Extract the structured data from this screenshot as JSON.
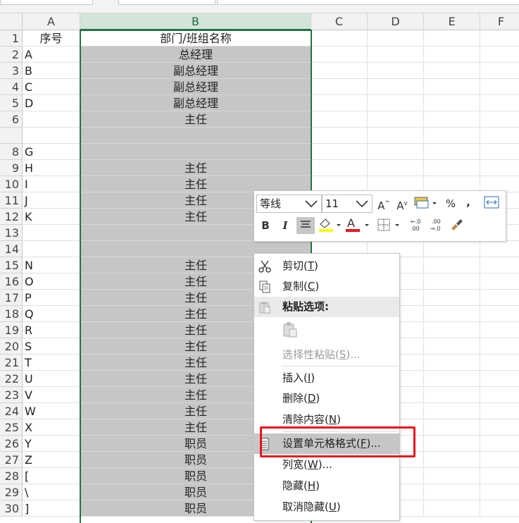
{
  "columns": [
    "A",
    "B",
    "C",
    "D",
    "E",
    "F"
  ],
  "header_row": {
    "row": "1",
    "a": "序号",
    "b": "部门/班组名称"
  },
  "rows": [
    {
      "num": "2",
      "a": "A",
      "b": "总经理"
    },
    {
      "num": "3",
      "a": "B",
      "b": "副总经理"
    },
    {
      "num": "4",
      "a": "C",
      "b": "副总经理"
    },
    {
      "num": "5",
      "a": "D",
      "b": "副总经理"
    },
    {
      "num": "6",
      "a": "",
      "b": "主任"
    },
    {
      "num": "",
      "a": "",
      "b": ""
    },
    {
      "num": "8",
      "a": "G",
      "b": ""
    },
    {
      "num": "9",
      "a": "H",
      "b": "主任"
    },
    {
      "num": "10",
      "a": "I",
      "b": "主任"
    },
    {
      "num": "11",
      "a": "J",
      "b": "主任"
    },
    {
      "num": "12",
      "a": "K",
      "b": "主任"
    },
    {
      "num": "13",
      "a": "",
      "b": ""
    },
    {
      "num": "14",
      "a": "",
      "b": ""
    },
    {
      "num": "15",
      "a": "N",
      "b": "主任"
    },
    {
      "num": "16",
      "a": "O",
      "b": "主任"
    },
    {
      "num": "17",
      "a": "P",
      "b": "主任"
    },
    {
      "num": "18",
      "a": "Q",
      "b": "主任"
    },
    {
      "num": "19",
      "a": "R",
      "b": "主任"
    },
    {
      "num": "20",
      "a": "S",
      "b": "主任"
    },
    {
      "num": "21",
      "a": "T",
      "b": "主任"
    },
    {
      "num": "22",
      "a": "U",
      "b": "主任"
    },
    {
      "num": "23",
      "a": "V",
      "b": "主任"
    },
    {
      "num": "24",
      "a": "W",
      "b": "主任"
    },
    {
      "num": "25",
      "a": "X",
      "b": "主任"
    },
    {
      "num": "26",
      "a": "Y",
      "b": "职员"
    },
    {
      "num": "27",
      "a": "Z",
      "b": "职员"
    },
    {
      "num": "28",
      "a": "[",
      "b": "职员"
    },
    {
      "num": "29",
      "a": "\\",
      "b": "职员"
    },
    {
      "num": "30",
      "a": "]",
      "b": "职员"
    }
  ],
  "mini_toolbar": {
    "font_name": "等线",
    "font_size": "11",
    "percent": "%",
    "comma": ",",
    "bold": "B",
    "italic": "I",
    "font_color_letter": "A",
    "grow_font": "A",
    "shrink_font": "A",
    "fill_color": "#ffff00",
    "font_color": "#e8141c"
  },
  "context_menu": {
    "cut": {
      "label": "剪切(",
      "key": "T",
      "end": ")"
    },
    "copy": {
      "label": "复制(",
      "key": "C",
      "end": ")"
    },
    "paste_options": "粘贴选项:",
    "paste_special": {
      "label": "选择性粘贴(",
      "key": "S",
      "end": ")..."
    },
    "insert": {
      "label": "插入(",
      "key": "I",
      "end": ")"
    },
    "delete": {
      "label": "删除(",
      "key": "D",
      "end": ")"
    },
    "clear": {
      "label": "清除内容(",
      "key": "N",
      "end": ")"
    },
    "format_cells": {
      "label": "设置单元格格式(",
      "key": "F",
      "end": ")..."
    },
    "column_width": {
      "label": "列宽(",
      "key": "W",
      "end": ")..."
    },
    "hide": {
      "label": "隐藏(",
      "key": "H",
      "end": ")"
    },
    "unhide": {
      "label": "取消隐藏(",
      "key": "U",
      "end": ")"
    }
  },
  "colors": {
    "selection": "#217346",
    "highlight": "#e8141c"
  }
}
